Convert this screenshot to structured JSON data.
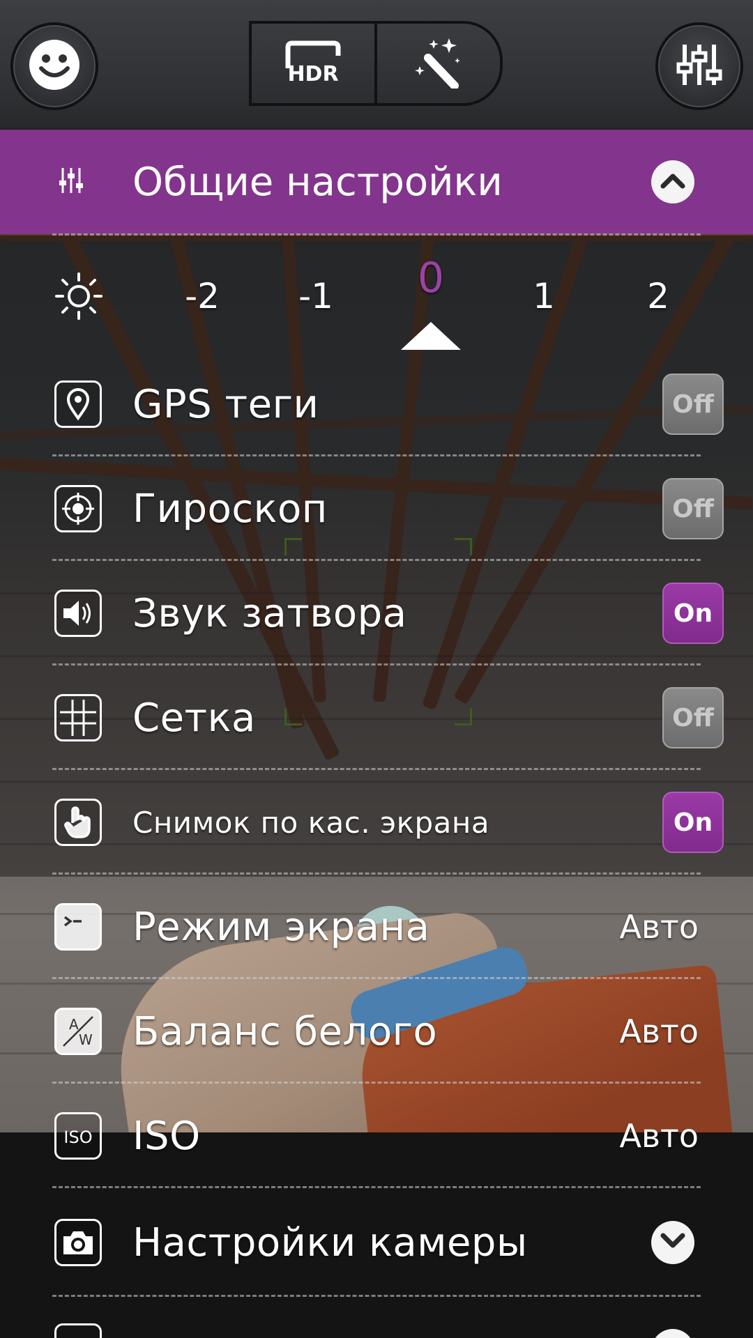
{
  "top_bar": {
    "hdr_label": "HDR",
    "icons": [
      "smile-icon",
      "hdr-icon",
      "magic-wand-icon",
      "settings-sliders-icon"
    ]
  },
  "general_settings": {
    "title": "Общие настройки",
    "expanded": true
  },
  "exposure": {
    "values": [
      "-2",
      "-1",
      "0",
      "1",
      "2"
    ],
    "selected": "0"
  },
  "toggle_rows": [
    {
      "label": "GPS теги",
      "state": "Off",
      "icon": "location-pin-icon"
    },
    {
      "label": "Гироскоп",
      "state": "Off",
      "icon": "gyroscope-icon"
    },
    {
      "label": "Звук затвора",
      "state": "On",
      "icon": "speaker-icon"
    },
    {
      "label": "Сетка",
      "state": "Off",
      "icon": "grid-icon"
    },
    {
      "label": "Снимок по кас. экрана",
      "state": "On",
      "icon": "touch-hand-icon"
    }
  ],
  "value_rows": [
    {
      "label": "Режим экрана",
      "value": "Авто",
      "icon": "screen-mode-icon"
    },
    {
      "label": "Баланс белого",
      "value": "Авто",
      "icon": "white-balance-icon"
    },
    {
      "label": "ISO",
      "value": "Авто",
      "icon": "iso-icon"
    }
  ],
  "camera_settings": {
    "title": "Настройки камеры",
    "expanded": false
  },
  "colors": {
    "accent": "#8c3796",
    "toggle_off": "#7a7a7a",
    "toggle_on": "#8f339b"
  }
}
